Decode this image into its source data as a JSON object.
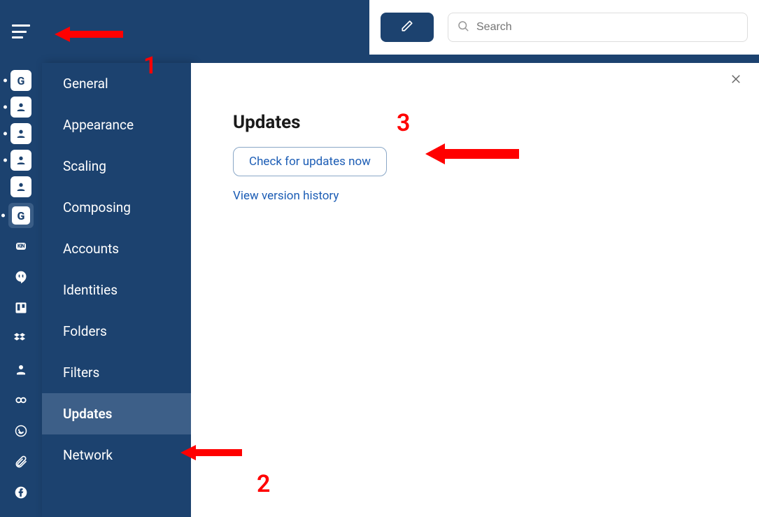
{
  "topbar": {
    "compose_icon": "pencil",
    "search_placeholder": "Search"
  },
  "rail_icons": [
    {
      "name": "google-icon",
      "glyph": "G",
      "boxed": true,
      "dot": true
    },
    {
      "name": "person-icon",
      "glyph": "person",
      "boxed": true,
      "dot": true
    },
    {
      "name": "person-icon",
      "glyph": "person",
      "boxed": true,
      "dot": true
    },
    {
      "name": "person-icon",
      "glyph": "person",
      "boxed": true,
      "dot": true
    },
    {
      "name": "person-icon",
      "glyph": "person",
      "boxed": true,
      "dot": false
    },
    {
      "name": "google-icon",
      "glyph": "G",
      "boxed": true,
      "dot": true,
      "active": true
    },
    {
      "name": "kin-icon",
      "glyph": "KIN",
      "boxed": false
    },
    {
      "name": "hangouts-icon",
      "glyph": "hangouts",
      "boxed": false
    },
    {
      "name": "trello-icon",
      "glyph": "trello",
      "boxed": false
    },
    {
      "name": "dropbox-icon",
      "glyph": "dropbox",
      "boxed": false
    },
    {
      "name": "person-solid-icon",
      "glyph": "person-solid",
      "boxed": false
    },
    {
      "name": "link-icon",
      "glyph": "link",
      "boxed": false
    },
    {
      "name": "whatsapp-icon",
      "glyph": "whatsapp",
      "boxed": false
    },
    {
      "name": "attachment-icon",
      "glyph": "paperclip",
      "boxed": false
    },
    {
      "name": "facebook-icon",
      "glyph": "facebook",
      "boxed": false
    }
  ],
  "settings_nav": [
    {
      "label": "General"
    },
    {
      "label": "Appearance"
    },
    {
      "label": "Scaling"
    },
    {
      "label": "Composing"
    },
    {
      "label": "Accounts"
    },
    {
      "label": "Identities"
    },
    {
      "label": "Folders"
    },
    {
      "label": "Filters"
    },
    {
      "label": "Updates",
      "active": true
    },
    {
      "label": "Network"
    }
  ],
  "pane": {
    "title": "Updates",
    "check_button_label": "Check for updates now",
    "history_link_label": "View version history"
  },
  "annotations": {
    "one": "1",
    "two": "2",
    "three": "3"
  }
}
